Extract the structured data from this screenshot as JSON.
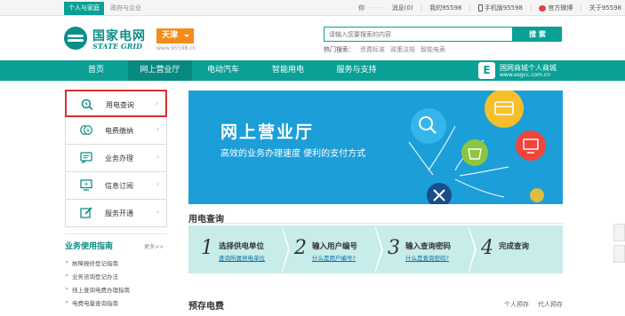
{
  "topbar": {
    "tab_personal": "个人与家庭",
    "tab_business": "政府与企业",
    "user_prefix": "你",
    "user_blur": "·······",
    "message": "消息(0)",
    "my95598": "我的95598",
    "mobile": "手机版95598",
    "weibo": "官方微博",
    "about": "关于95598"
  },
  "header": {
    "logo_cn": "国家电网",
    "logo_en": "STATE GRID",
    "city": "天津",
    "site": "www.95598.cn",
    "search_placeholder": "请输入您要搜索的内容",
    "search_button": "搜 索",
    "hot_label": "热门搜索：",
    "hot_keywords": [
      "资费标准",
      "政策法规",
      "智能电表"
    ]
  },
  "nav": {
    "items": [
      "首页",
      "网上营业厅",
      "电动汽车",
      "智能用电",
      "服务与支持"
    ],
    "active_index": 1,
    "mall_title": "国网商城个人商城",
    "mall_url": "www.esgcc.com.cn",
    "mall_icon": "E"
  },
  "sidebar": {
    "items": [
      {
        "label": "用电查询",
        "icon": "search-bolt-icon"
      },
      {
        "label": "电费缴纳",
        "icon": "coins-icon"
      },
      {
        "label": "业务办理",
        "icon": "chat-icon"
      },
      {
        "label": "信息订阅",
        "icon": "monitor-icon"
      },
      {
        "label": "服务开通",
        "icon": "edit-icon"
      }
    ],
    "arrow": "›"
  },
  "guide": {
    "title": "业务使用指南",
    "more": "更多>>",
    "items": [
      "故障报修登记指南",
      "业务咨询登记办法",
      "线上查询电费办理指南",
      "电费电量查询指南"
    ]
  },
  "banner": {
    "title": "网上营业厅",
    "subtitle": "高效的业务办理速度  便利的支付方式"
  },
  "query_section": {
    "title": "用电查询",
    "steps": [
      {
        "num": "1",
        "title": "选择供电单位",
        "link": "查询所属供电单位"
      },
      {
        "num": "2",
        "title": "输入用户编号",
        "link": "什么是用户编号?"
      },
      {
        "num": "3",
        "title": "输入查询密码",
        "link": "什么是查询密码?"
      },
      {
        "num": "4",
        "title": "完成查询",
        "link": ""
      }
    ]
  },
  "prepay": {
    "title": "预存电费",
    "tabs": [
      "个人预存",
      "代人预存"
    ]
  },
  "colors": {
    "primary": "#0aa096",
    "banner": "#1c9ed8",
    "city_badge": "#f28c1a",
    "highlight": "#d93030"
  }
}
